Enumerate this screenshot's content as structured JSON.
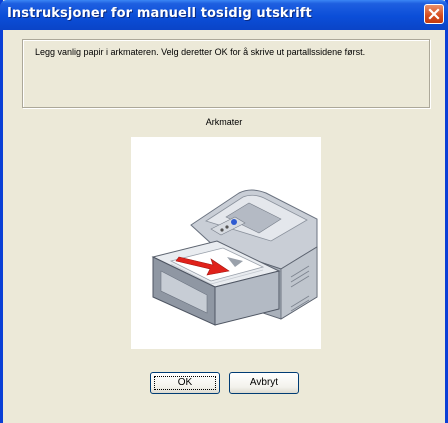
{
  "window": {
    "title": "Instruksjoner for manuell tosidig utskrift"
  },
  "message": "Legg vanlig papir i arkmateren. Velg deretter OK for å skrive ut partallssidene først.",
  "illustration": {
    "caption": "Arkmater"
  },
  "buttons": {
    "ok": "OK",
    "cancel": "Avbryt"
  },
  "colors": {
    "titlebar": "#0b4ed8",
    "close": "#d64c1e",
    "dialog_bg": "#ece9d8"
  }
}
